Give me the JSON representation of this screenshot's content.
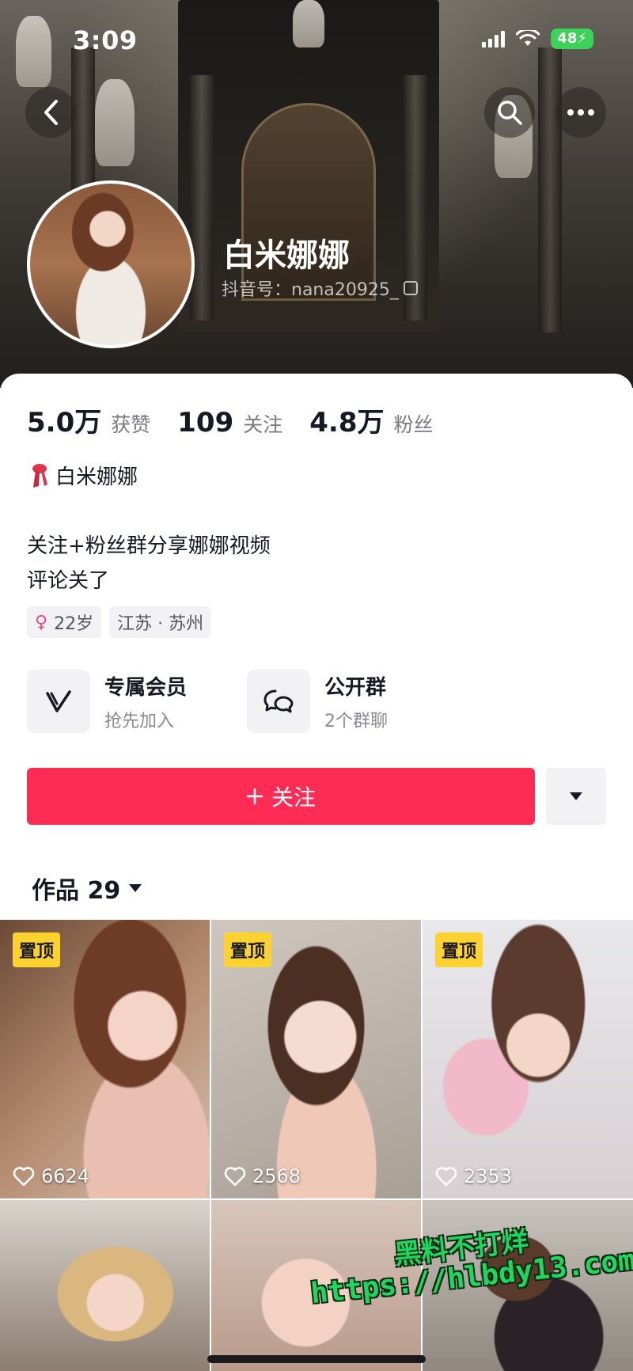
{
  "status_bar": {
    "time": "3:09",
    "battery": "48"
  },
  "header": {
    "name": "白米娜娜",
    "douyin_id": "抖音号：nana20925_"
  },
  "stats": [
    {
      "value": "5.0万",
      "label": "获赞"
    },
    {
      "value": "109",
      "label": "关注"
    },
    {
      "value": "4.8万",
      "label": "粉丝"
    }
  ],
  "badge": {
    "text": "白米娜娜",
    "icon": "scarf-icon"
  },
  "bio": {
    "line1": "关注+粉丝群分享娜娜视频",
    "line2": "评论关了"
  },
  "tags": {
    "age": "22岁",
    "location": "江苏 · 苏州"
  },
  "features": [
    {
      "title": "专属会员",
      "subtitle": "抢先加入",
      "icon": "vip-v-icon"
    },
    {
      "title": "公开群",
      "subtitle": "2个群聊",
      "icon": "chat-bubbles-icon"
    }
  ],
  "actions": {
    "follow_label": "关注",
    "follow_color": "#fe2c55"
  },
  "works_tab": {
    "label": "作品 29"
  },
  "videos": [
    {
      "pinned": true,
      "pin_label": "置顶",
      "likes": "6624"
    },
    {
      "pinned": true,
      "pin_label": "置顶",
      "likes": "2568"
    },
    {
      "pinned": true,
      "pin_label": "置顶",
      "likes": "2353"
    },
    {
      "pinned": false,
      "likes": ""
    },
    {
      "pinned": false,
      "likes": ""
    },
    {
      "pinned": false,
      "likes": ""
    }
  ],
  "watermark": {
    "line1": "黑料不打烊",
    "line2": "https://hlbdy13.com"
  }
}
